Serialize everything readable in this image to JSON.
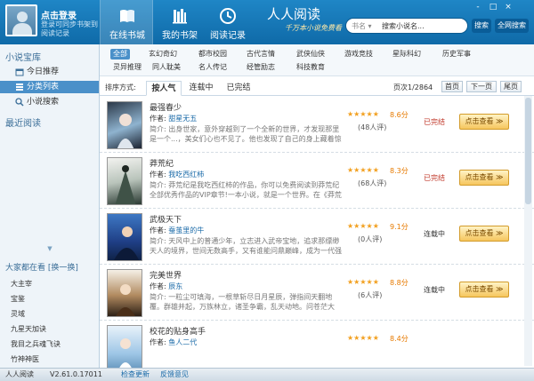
{
  "header": {
    "login_link": "点击登录",
    "login_sub": "登录可同步书架到阅读记录",
    "tabs": [
      {
        "label": "在线书城",
        "icon": "book-icon"
      },
      {
        "label": "我的书架",
        "icon": "bookshelf-icon"
      },
      {
        "label": "阅读记录",
        "icon": "clock-icon"
      }
    ],
    "brand": "人人阅读",
    "brand_sub": "千万本小说免费看",
    "search_type": "书名",
    "search_value": "搜索小说名...",
    "search_button": "搜索",
    "advanced_search": "全网搜索",
    "window_controls": [
      "-",
      "□",
      "×"
    ]
  },
  "sidebar": {
    "section_title": "小说宝库",
    "items": [
      {
        "label": "今日推荐",
        "icon": "calendar-icon"
      },
      {
        "label": "分类列表",
        "icon": "list-icon"
      },
      {
        "label": "小说搜索",
        "icon": "search-icon"
      }
    ],
    "recent_title": "最近阅读",
    "hot_title": "大家都在看 [换一换]",
    "hot_items": [
      "大主宰",
      "宝鉴",
      "灵域",
      "九星天加诀",
      "我目之兵魂飞诀",
      "竹神神医"
    ]
  },
  "categories": {
    "row1": [
      "全部",
      "玄幻奇幻",
      "都市校园",
      "古代言情",
      "武侠仙侠",
      "游戏竞技",
      "星际科幻",
      "历史军事"
    ],
    "row2": [
      "灵异推理",
      "同人耽美",
      "名人传记",
      "经管励志",
      "科技教育"
    ]
  },
  "sortbar": {
    "label": "排序方式:",
    "tabs": [
      "按人气",
      "连载中",
      "已完结"
    ],
    "page_info": "页次1/2864",
    "buttons": [
      "首页",
      "下一页",
      "尾页"
    ]
  },
  "books": [
    {
      "title": "最强春少",
      "author_label": "作者:",
      "author": "甜星无五",
      "desc": "简介: 出身世家，意外穿越到了一个全新的世界，才发现那里是一个...，美女们心也不见了。他也发现了自己的身上藏着惊天的秘密。",
      "stars": "★★★★★",
      "score": "8.6分",
      "reviews": "(48人评)",
      "status": "已完结",
      "button": "点击查看 ≫"
    },
    {
      "title": "莽荒纪",
      "author_label": "作者:",
      "author": "我吃西红柿",
      "desc": "简介: 莽荒纪是我吃西红柿的作品，你可以免费阅读到莽荒纪全部优秀作品的VIP章节!一本小说，就是一个世界。在《莽荒纪》",
      "stars": "★★★★★",
      "score": "8.3分",
      "reviews": "(68人评)",
      "status": "已完结",
      "button": "点击查看 ≫"
    },
    {
      "title": "武极天下",
      "author_label": "作者:",
      "author": "蚕茧里的牛",
      "desc": "简介: 天风中上的普通少年，立志进入武帝宝地，追求那缥缈天人的境界，世间无数高手，又有谁能问鼎巅峰，成为一代强者。",
      "stars": "★★★★★",
      "score": "9.1分",
      "reviews": "(0人评)",
      "status": "连载中",
      "button": "点击查看 ≫"
    },
    {
      "title": "完美世界",
      "author_label": "作者:",
      "author": "辰东",
      "desc": "简介: 一粒尘可填海，一根草斩尽日月星辰，弹指间天翻地覆。群雄并起，万族林立，诸圣争霸，乱天动地。问苍茫大地，谁主",
      "stars": "★★★★★",
      "score": "8.8分",
      "reviews": "(6人评)",
      "status": "连载中",
      "button": "点击查看 ≫"
    },
    {
      "title": "校花的贴身高手",
      "author_label": "作者:",
      "author": "鱼人二代",
      "desc": "",
      "stars": "★★★★★",
      "score": "8.4分",
      "reviews": "",
      "status": "",
      "button": ""
    }
  ],
  "statusbar": {
    "app": "人人阅读",
    "version": "V2.61.0.17011",
    "check_update": "检查更新",
    "feedback": "反馈意见"
  },
  "colors": {
    "header_blue": "#1f86c6",
    "accent_orange": "#e77a00",
    "completed_red": "#c0392b",
    "ongoing_text": "#333333"
  }
}
